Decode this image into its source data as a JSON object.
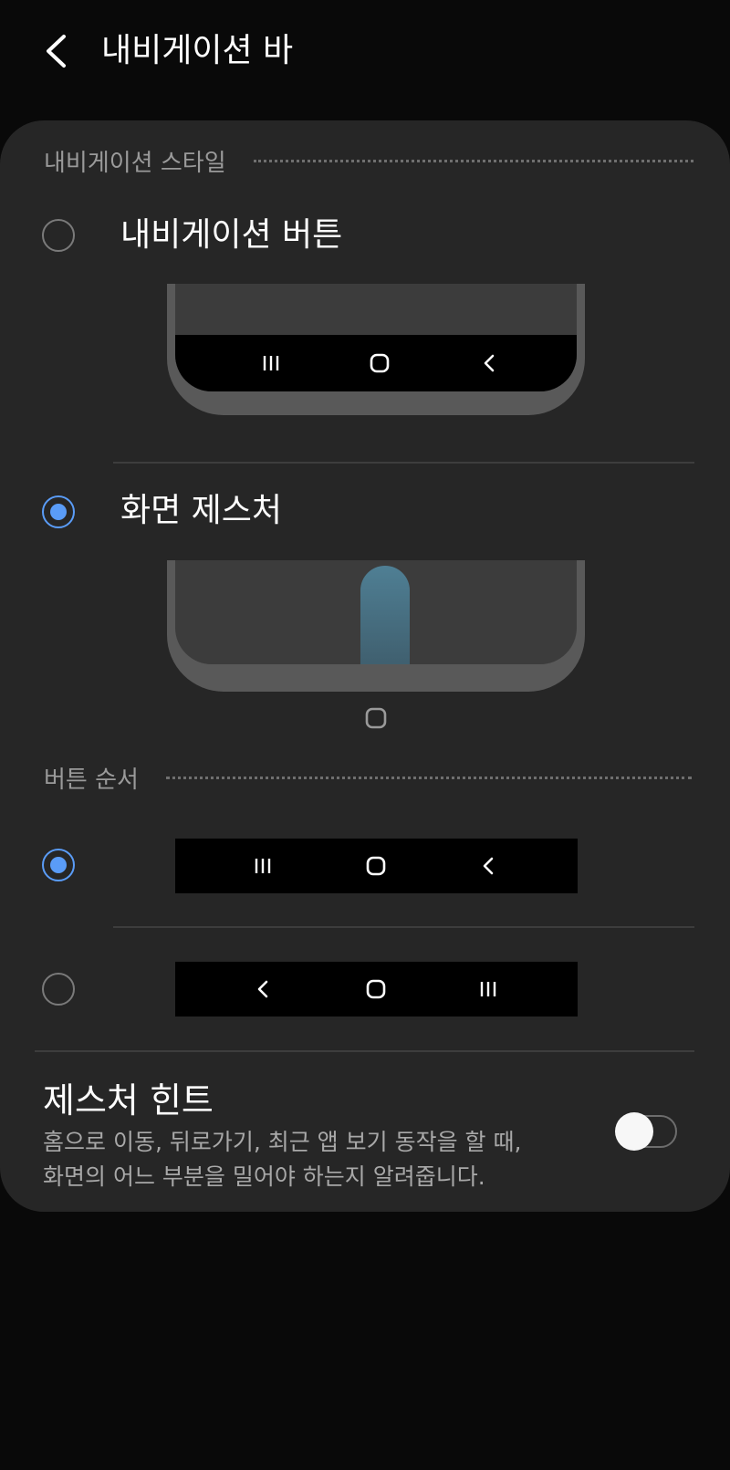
{
  "header": {
    "title": "내비게이션 바",
    "back_icon": "back-arrow-icon"
  },
  "navigation_style": {
    "section_title": "내비게이션 스타일",
    "options": [
      {
        "label": "내비게이션 버튼",
        "selected": false
      },
      {
        "label": "화면 제스처",
        "selected": true
      }
    ]
  },
  "button_order": {
    "section_title": "버튼 순서",
    "options": [
      {
        "icons": [
          "recents-icon",
          "home-icon",
          "back-icon"
        ],
        "selected": true
      },
      {
        "icons": [
          "back-icon",
          "home-icon",
          "recents-icon"
        ],
        "selected": false
      }
    ]
  },
  "gesture_hint": {
    "title": "제스처 힌트",
    "description_line1": "홈으로 이동, 뒤로가기, 최근 앱 보기 동작을 할 때,",
    "description_line2": "화면의 어느 부분을 밀어야 하는지 알려줍니다.",
    "enabled": false
  },
  "colors": {
    "accent": "#5a9cf7",
    "card": "#262626",
    "background": "#090909"
  }
}
